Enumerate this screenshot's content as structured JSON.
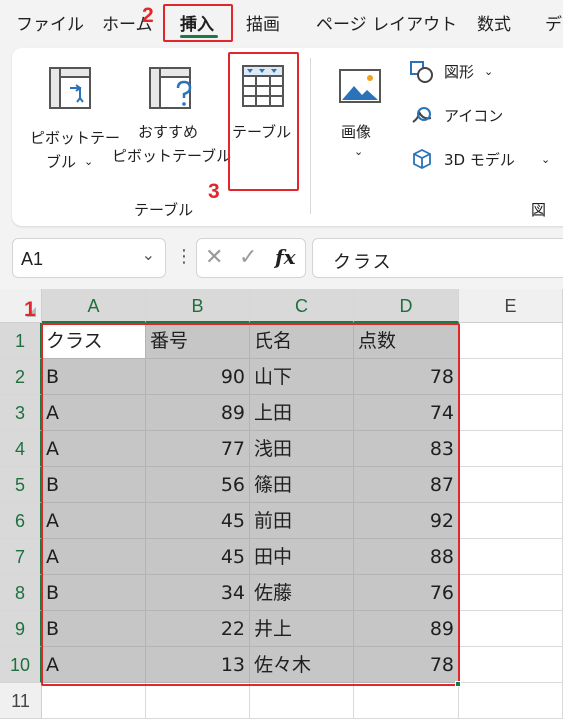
{
  "menu": {
    "tabs": [
      "ファイル",
      "ホーム",
      "挿入",
      "描画",
      "ページ レイアウト",
      "数式",
      "デ"
    ],
    "active": "挿入"
  },
  "steps": [
    "1",
    "2",
    "3"
  ],
  "ribbon": {
    "pivot_table": [
      "ピボットテー",
      "ブル"
    ],
    "recommended_pivot": [
      "おすすめ",
      "ピボットテーブル"
    ],
    "table": "テーブル",
    "image": "画像",
    "shapes": "図形",
    "icons": "アイコン",
    "models3d": "3D モデル",
    "group_table": "テーブル",
    "group_figure": "図"
  },
  "formula_bar": {
    "name_box": "A1",
    "fx": "fx",
    "content": "クラス"
  },
  "sheet": {
    "columns": [
      "A",
      "B",
      "C",
      "D",
      "E"
    ],
    "rows": [
      "1",
      "2",
      "3",
      "4",
      "5",
      "6",
      "7",
      "8",
      "9",
      "10",
      "11"
    ],
    "headers": [
      "クラス",
      "番号",
      "氏名",
      "点数"
    ],
    "data": [
      [
        "B",
        "90",
        "山下",
        "78"
      ],
      [
        "A",
        "89",
        "上田",
        "74"
      ],
      [
        "A",
        "77",
        "浅田",
        "83"
      ],
      [
        "B",
        "56",
        "篠田",
        "87"
      ],
      [
        "A",
        "45",
        "前田",
        "92"
      ],
      [
        "A",
        "45",
        "田中",
        "88"
      ],
      [
        "B",
        "34",
        "佐藤",
        "76"
      ],
      [
        "B",
        "22",
        "井上",
        "89"
      ],
      [
        "A",
        "13",
        "佐々木",
        "78"
      ]
    ]
  },
  "colors": {
    "accent": "#1b7a43",
    "annotation": "#e3262b",
    "selection": "#c6c6c6"
  }
}
